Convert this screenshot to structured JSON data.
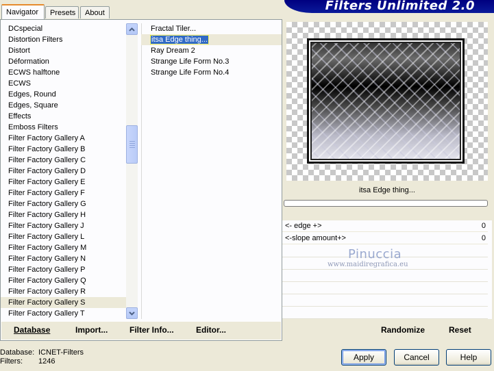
{
  "tabs": [
    {
      "label": "Navigator",
      "active": true
    },
    {
      "label": "Presets",
      "active": false
    },
    {
      "label": "About",
      "active": false
    }
  ],
  "banner": {
    "title": "Filters Unlimited 2.0"
  },
  "categories": {
    "items": [
      "DCspecial",
      "Distortion Filters",
      "Distort",
      "Déformation",
      "ECWS halftone",
      "ECWS",
      "Edges, Round",
      "Edges, Square",
      "Effects",
      "Emboss Filters",
      "Filter Factory Gallery A",
      "Filter Factory Gallery B",
      "Filter Factory Gallery C",
      "Filter Factory Gallery D",
      "Filter Factory Gallery E",
      "Filter Factory Gallery F",
      "Filter Factory Gallery G",
      "Filter Factory Gallery H",
      "Filter Factory Gallery J",
      "Filter Factory Gallery L",
      "Filter Factory Gallery M",
      "Filter Factory Gallery N",
      "Filter Factory Gallery P",
      "Filter Factory Gallery Q",
      "Filter Factory Gallery R",
      "Filter Factory Gallery S",
      "Filter Factory Gallery T"
    ],
    "selected_index": 25
  },
  "filters": {
    "items": [
      "Fractal Tiler...",
      "itsa Edge thing...",
      "Ray Dream 2",
      "Strange Life Form No.3",
      "Strange Life Form No.4"
    ],
    "selected_index": 1
  },
  "bottom_buttons": {
    "database": "Database",
    "import": "Import...",
    "filter_info": "Filter Info...",
    "editor": "Editor...",
    "randomize": "Randomize",
    "reset": "Reset"
  },
  "preview": {
    "filter_name": "itsa Edge thing..."
  },
  "params": [
    {
      "label": "<- edge +>",
      "value": "0"
    },
    {
      "label": "<-slope amount+>",
      "value": "0"
    }
  ],
  "watermark": {
    "name": "Pinuccia",
    "url": "www.maidiregrafica.eu"
  },
  "status": {
    "database_label": "Database:",
    "database_value": "ICNET-Filters",
    "filters_label": "Filters:",
    "filters_value": "1246"
  },
  "dialog_buttons": {
    "apply": "Apply",
    "cancel": "Cancel",
    "help": "Help"
  }
}
